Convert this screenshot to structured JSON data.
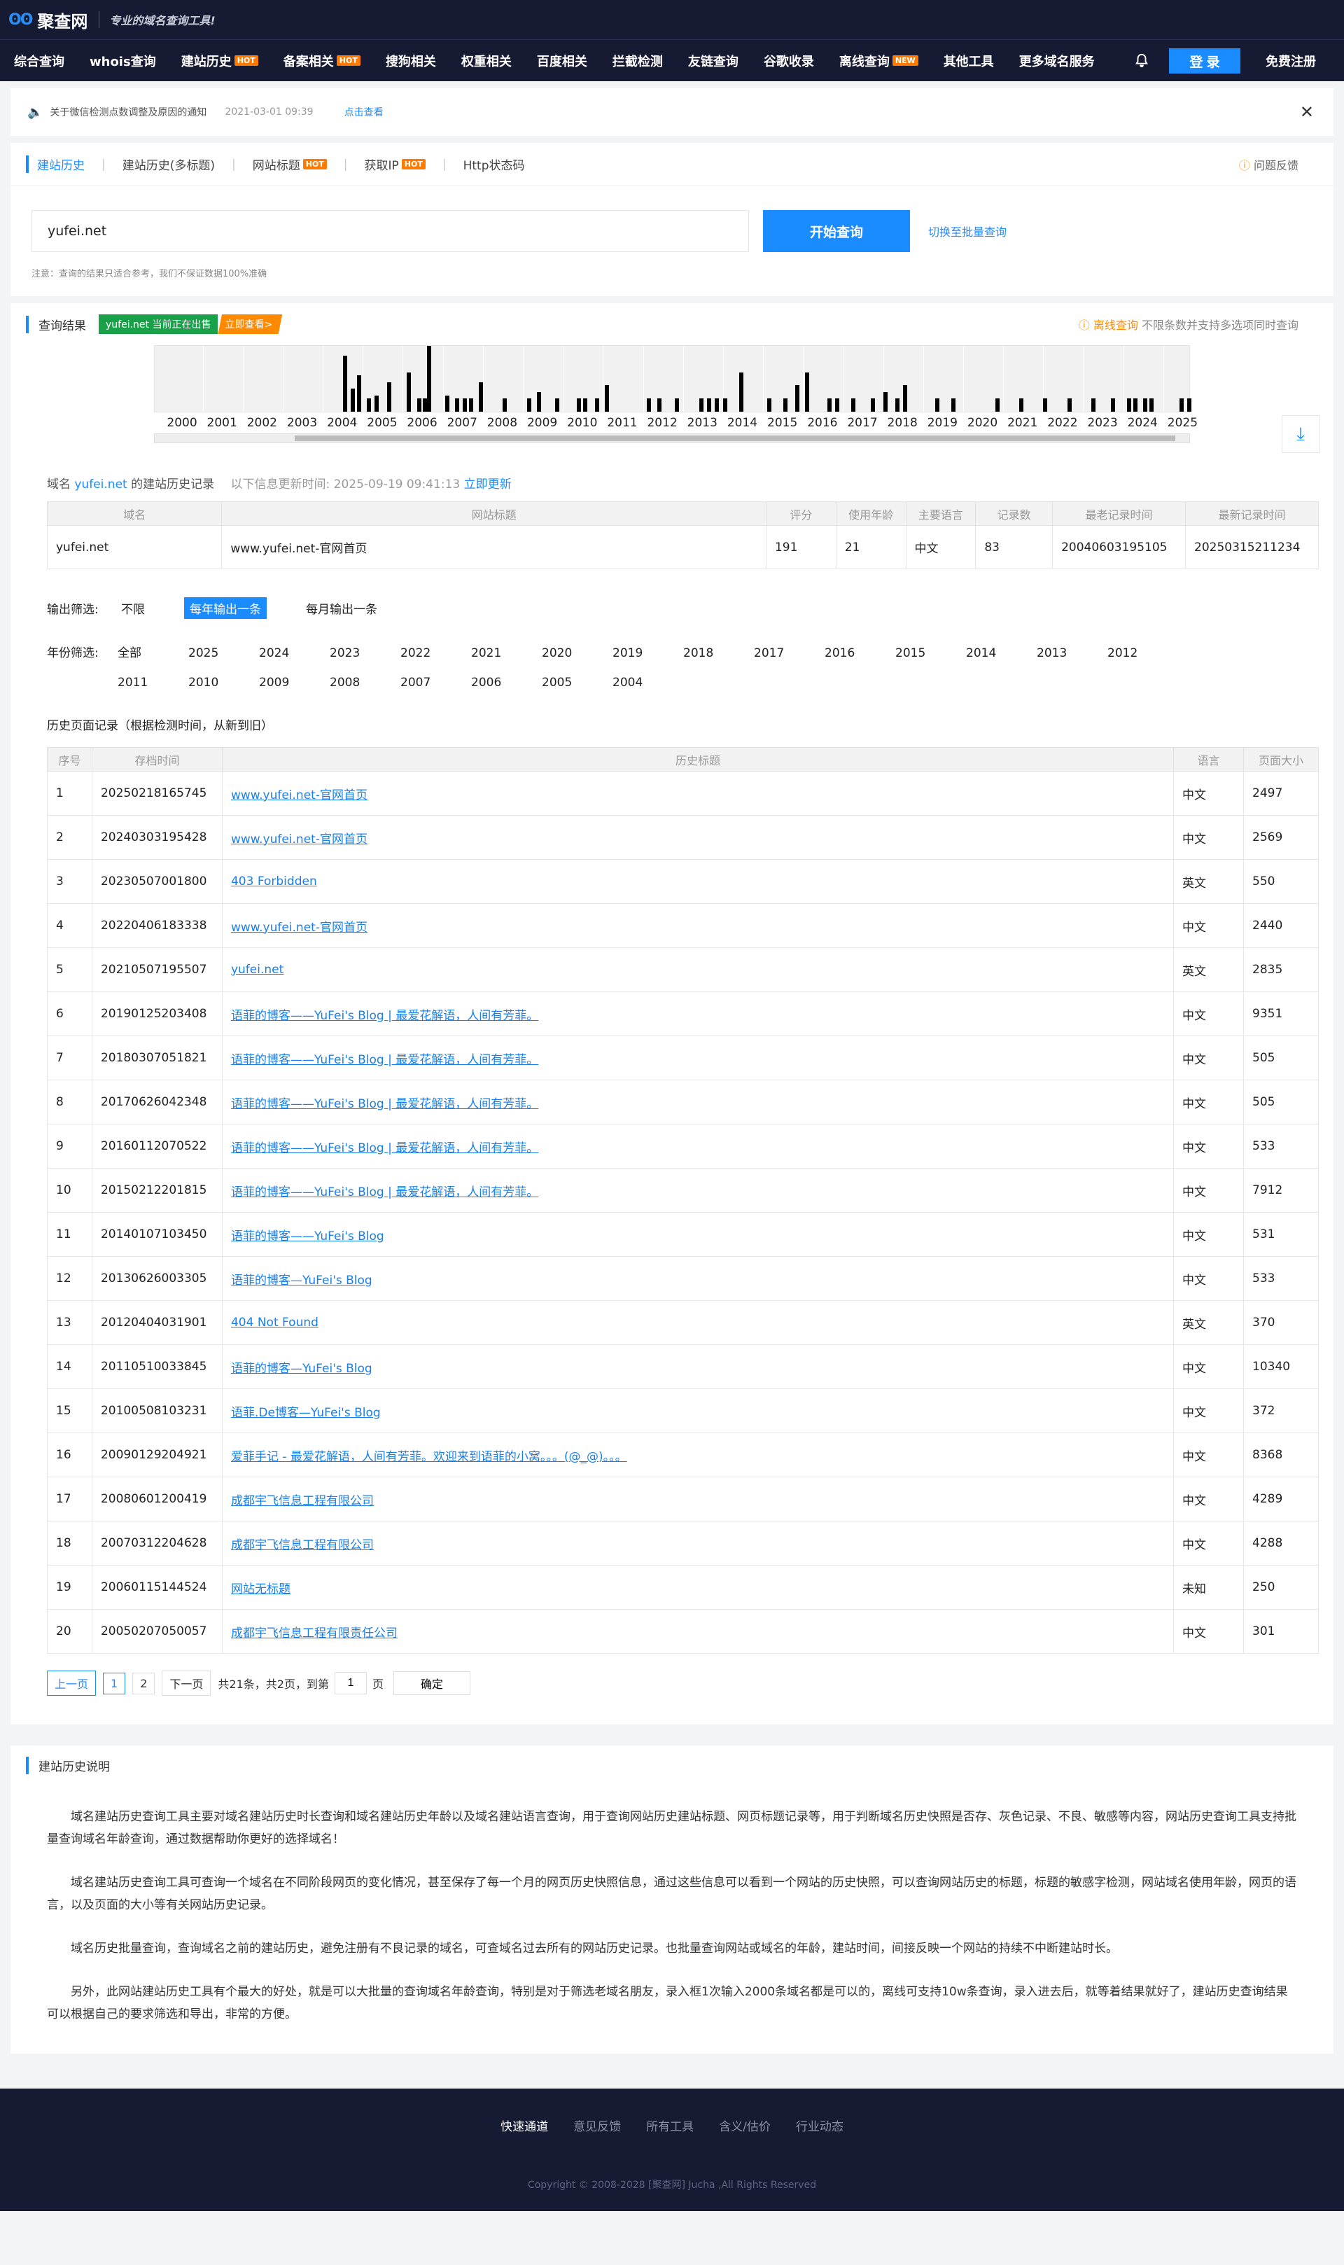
{
  "brand": {
    "name": "聚查网",
    "slogan": "专业的域名查询工具!"
  },
  "nav": {
    "items": [
      {
        "label": "综合查询",
        "badge": ""
      },
      {
        "label": "whois查询",
        "badge": ""
      },
      {
        "label": "建站历史",
        "badge": "HOT"
      },
      {
        "label": "备案相关",
        "badge": "HOT"
      },
      {
        "label": "搜狗相关",
        "badge": ""
      },
      {
        "label": "权重相关",
        "badge": ""
      },
      {
        "label": "百度相关",
        "badge": ""
      },
      {
        "label": "拦截检测",
        "badge": ""
      },
      {
        "label": "友链查询",
        "badge": ""
      },
      {
        "label": "谷歌收录",
        "badge": ""
      },
      {
        "label": "离线查询",
        "badge": "NEW"
      },
      {
        "label": "其他工具",
        "badge": ""
      },
      {
        "label": "更多域名服务",
        "badge": ""
      }
    ],
    "login": "登 录",
    "register": "免费注册"
  },
  "notice": {
    "text": "关于微信检测点数调整及原因的通知",
    "date": "2021-03-01 09:39",
    "view": "点击查看",
    "close": "✕"
  },
  "tabs": [
    {
      "label": "建站历史",
      "badge": ""
    },
    {
      "label": "建站历史(多标题)",
      "badge": ""
    },
    {
      "label": "网站标题",
      "badge": "HOT"
    },
    {
      "label": "获取IP",
      "badge": "HOT"
    },
    {
      "label": "Http状态码",
      "badge": ""
    }
  ],
  "feedback": "问题反馈",
  "search": {
    "value": "yufei.net",
    "button": "开始查询",
    "batch": "切换至批量查询",
    "note": "注意：查询的结果只适合参考，我们不保证数据100%准确"
  },
  "results": {
    "title": "查询结果",
    "sale_green": "yufei.net 当前正在出售",
    "sale_orange": "立即查看>",
    "offline_label": "离线查询",
    "offline_desc": "不限条数并支持多选项同时查询"
  },
  "timeline": {
    "years": [
      "2000",
      "2001",
      "2002",
      "2003",
      "2004",
      "2005",
      "2006",
      "2007",
      "2008",
      "2009",
      "2010",
      "2011",
      "2012",
      "2013",
      "2014",
      "2015",
      "2016",
      "2017",
      "2018",
      "2019",
      "2020",
      "2021",
      "2022",
      "2023",
      "2024",
      "2025"
    ],
    "bars": [
      {
        "x": 2004.0,
        "h": 0.85
      },
      {
        "x": 2004.2,
        "h": 0.35
      },
      {
        "x": 2004.35,
        "h": 0.55
      },
      {
        "x": 2004.6,
        "h": 0.2
      },
      {
        "x": 2004.8,
        "h": 0.25
      },
      {
        "x": 2005.1,
        "h": 0.45
      },
      {
        "x": 2005.6,
        "h": 0.6
      },
      {
        "x": 2005.85,
        "h": 0.2
      },
      {
        "x": 2006.0,
        "h": 0.2
      },
      {
        "x": 2006.1,
        "h": 1.0
      },
      {
        "x": 2006.55,
        "h": 0.25
      },
      {
        "x": 2006.8,
        "h": 0.2
      },
      {
        "x": 2007.0,
        "h": 0.2
      },
      {
        "x": 2007.15,
        "h": 0.2
      },
      {
        "x": 2007.4,
        "h": 0.45
      },
      {
        "x": 2008.0,
        "h": 0.2
      },
      {
        "x": 2008.6,
        "h": 0.2
      },
      {
        "x": 2008.85,
        "h": 0.3
      },
      {
        "x": 2009.3,
        "h": 0.2
      },
      {
        "x": 2009.85,
        "h": 0.2
      },
      {
        "x": 2010.0,
        "h": 0.2
      },
      {
        "x": 2010.3,
        "h": 0.2
      },
      {
        "x": 2010.55,
        "h": 0.4
      },
      {
        "x": 2011.6,
        "h": 0.2
      },
      {
        "x": 2011.85,
        "h": 0.2
      },
      {
        "x": 2012.3,
        "h": 0.2
      },
      {
        "x": 2012.9,
        "h": 0.2
      },
      {
        "x": 2013.1,
        "h": 0.2
      },
      {
        "x": 2013.3,
        "h": 0.2
      },
      {
        "x": 2013.5,
        "h": 0.2
      },
      {
        "x": 2013.9,
        "h": 0.6
      },
      {
        "x": 2014.6,
        "h": 0.2
      },
      {
        "x": 2015.0,
        "h": 0.2
      },
      {
        "x": 2015.3,
        "h": 0.4
      },
      {
        "x": 2015.55,
        "h": 0.6
      },
      {
        "x": 2016.1,
        "h": 0.2
      },
      {
        "x": 2016.3,
        "h": 0.2
      },
      {
        "x": 2016.7,
        "h": 0.2
      },
      {
        "x": 2017.2,
        "h": 0.2
      },
      {
        "x": 2017.5,
        "h": 0.3
      },
      {
        "x": 2017.8,
        "h": 0.2
      },
      {
        "x": 2018.0,
        "h": 0.4
      },
      {
        "x": 2018.8,
        "h": 0.2
      },
      {
        "x": 2019.2,
        "h": 0.2
      },
      {
        "x": 2020.3,
        "h": 0.2
      },
      {
        "x": 2020.9,
        "h": 0.2
      },
      {
        "x": 2021.5,
        "h": 0.2
      },
      {
        "x": 2022.1,
        "h": 0.2
      },
      {
        "x": 2022.7,
        "h": 0.2
      },
      {
        "x": 2023.2,
        "h": 0.2
      },
      {
        "x": 2023.6,
        "h": 0.2
      },
      {
        "x": 2023.75,
        "h": 0.2
      },
      {
        "x": 2024.0,
        "h": 0.2
      },
      {
        "x": 2024.15,
        "h": 0.2
      },
      {
        "x": 2024.9,
        "h": 0.2
      },
      {
        "x": 2025.1,
        "h": 0.2
      }
    ]
  },
  "domain_info": {
    "prefix": "域名",
    "domain": "yufei.net",
    "suffix": "的建站历史记录",
    "updated": "以下信息更新时间: 2025-09-19 09:41:13",
    "refresh": "立即更新"
  },
  "summary": {
    "headers": [
      "域名",
      "网站标题",
      "评分",
      "使用年龄",
      "主要语言",
      "记录数",
      "最老记录时间",
      "最新记录时间"
    ],
    "row": [
      "yufei.net",
      "www.yufei.net-官网首页",
      "191",
      "21",
      "中文",
      "83",
      "20040603195105",
      "20250315211234"
    ]
  },
  "output_filter": {
    "label": "输出筛选:",
    "options": [
      "不限",
      "每年输出一条",
      "每月输出一条"
    ],
    "active": 1
  },
  "year_filter": {
    "label": "年份筛选:",
    "options": [
      "全部",
      "2025",
      "2024",
      "2023",
      "2022",
      "2021",
      "2020",
      "2019",
      "2018",
      "2017",
      "2016",
      "2015",
      "2014",
      "2013",
      "2012",
      "2011",
      "2010",
      "2009",
      "2008",
      "2007",
      "2006",
      "2005",
      "2004"
    ]
  },
  "history": {
    "title": "历史页面记录（根据检测时间，从新到旧）",
    "headers": [
      "序号",
      "存档时间",
      "历史标题",
      "语言",
      "页面大小"
    ],
    "rows": [
      [
        "1",
        "20250218165745",
        "www.yufei.net-官网首页",
        "中文",
        "2497"
      ],
      [
        "2",
        "20240303195428",
        "www.yufei.net-官网首页",
        "中文",
        "2569"
      ],
      [
        "3",
        "20230507001800",
        "403 Forbidden",
        "英文",
        "550"
      ],
      [
        "4",
        "20220406183338",
        "www.yufei.net-官网首页",
        "中文",
        "2440"
      ],
      [
        "5",
        "20210507195507",
        "yufei.net",
        "英文",
        "2835"
      ],
      [
        "6",
        "20190125203408",
        "语菲的博客——YuFei's Blog | 最爱花解语，人间有芳菲。",
        "中文",
        "9351"
      ],
      [
        "7",
        "20180307051821",
        "语菲的博客——YuFei's Blog | 最爱花解语，人间有芳菲。",
        "中文",
        "505"
      ],
      [
        "8",
        "20170626042348",
        "语菲的博客——YuFei's Blog | 最爱花解语，人间有芳菲。",
        "中文",
        "505"
      ],
      [
        "9",
        "20160112070522",
        "语菲的博客——YuFei's Blog | 最爱花解语，人间有芳菲。",
        "中文",
        "533"
      ],
      [
        "10",
        "20150212201815",
        "语菲的博客——YuFei's Blog | 最爱花解语，人间有芳菲。",
        "中文",
        "7912"
      ],
      [
        "11",
        "20140107103450",
        "语菲的博客——YuFei's Blog",
        "中文",
        "531"
      ],
      [
        "12",
        "20130626003305",
        "语菲的博客—YuFei's Blog",
        "中文",
        "533"
      ],
      [
        "13",
        "20120404031901",
        "404 Not Found",
        "英文",
        "370"
      ],
      [
        "14",
        "20110510033845",
        "语菲的博客—YuFei's Blog",
        "中文",
        "10340"
      ],
      [
        "15",
        "20100508103231",
        "语菲.De博客—YuFei's Blog",
        "中文",
        "372"
      ],
      [
        "16",
        "20090129204921",
        "爱菲手记 - 最爱花解语，人间有芳菲。欢迎来到语菲的小窝。。。(@_@)。。。",
        "中文",
        "8368"
      ],
      [
        "17",
        "20080601200419",
        "成都宇飞信息工程有限公司",
        "中文",
        "4289"
      ],
      [
        "18",
        "20070312204628",
        "成都宇飞信息工程有限公司",
        "中文",
        "4288"
      ],
      [
        "19",
        "20060115144524",
        "网站无标题",
        "未知",
        "250"
      ],
      [
        "20",
        "20050207050057",
        "成都宇飞信息工程有限责任公司",
        "中文",
        "301"
      ]
    ]
  },
  "pager": {
    "prev": "上一页",
    "pages": [
      "1",
      "2"
    ],
    "next": "下一页",
    "total": "共21条，共2页，到第",
    "page_value": "1",
    "page_unit": "页",
    "ok": "确定"
  },
  "description": {
    "title": "建站历史说明",
    "paragraphs": [
      "域名建站历史查询工具主要对域名建站历史时长查询和域名建站历史年龄以及域名建站语言查询，用于查询网站历史建站标题、网页标题记录等，用于判断域名历史快照是否存、灰色记录、不良、敏感等内容，网站历史查询工具支持批量查询域名年龄查询，通过数据帮助你更好的选择域名！",
      "域名建站历史查询工具可查询一个域名在不同阶段网页的变化情况，甚至保存了每一个月的网页历史快照信息，通过这些信息可以看到一个网站的历史快照，可以查询网站历史的标题，标题的敏感字检测，网站域名使用年龄，网页的语言，以及页面的大小等有关网站历史记录。",
      "域名历史批量查询，查询域名之前的建站历史，避免注册有不良记录的域名，可查域名过去所有的网站历史记录。也批量查询网站或域名的年龄，建站时间，间接反映一个网站的持续不中断建站时长。",
      "另外，此网站建站历史工具有个最大的好处，就是可以大批量的查询域名年龄查询，特别是对于筛选老域名朋友，录入框1次输入2000条域名都是可以的，离线可支持10w条查询，录入进去后，就等着结果就好了，建站历史查询结果可以根据自己的要求筛选和导出，非常的方便。"
    ]
  },
  "footer": {
    "links": [
      "快速通道",
      "意见反馈",
      "所有工具",
      "含义/估价",
      "行业动态"
    ],
    "copyright": "Copyright © 2008-2028 [聚查网] Jucha ,All Rights Reserved"
  }
}
